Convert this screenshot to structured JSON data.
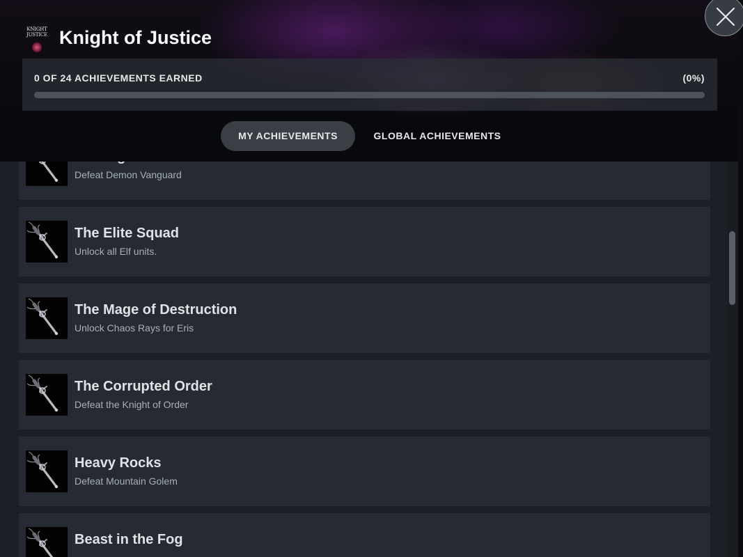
{
  "game": {
    "title": "Knight of Justice",
    "logo_line1": "KNIGHT",
    "logo_line2": "JUSTICE"
  },
  "progress": {
    "label": "0 OF 24 ACHIEVEMENTS EARNED",
    "percent_text": "(0%)",
    "earned": 0,
    "total": 24,
    "fraction": 0,
    "bar_color": "#1a9fff",
    "track_color": "#4d525b"
  },
  "tabs": [
    {
      "label": "MY ACHIEVEMENTS",
      "active": true
    },
    {
      "label": "GLOBAL ACHIEVEMENTS",
      "active": false
    }
  ],
  "achievements": [
    {
      "title": "Just Uglier",
      "description": "Defeat Demon Vanguard",
      "icon": "sword-icon"
    },
    {
      "title": "The Elite Squad",
      "description": "Unlock all Elf units.",
      "icon": "sword-icon"
    },
    {
      "title": "The Mage of Destruction",
      "description": "Unlock Chaos Rays for Eris",
      "icon": "sword-icon"
    },
    {
      "title": "The Corrupted Order",
      "description": "Defeat the Knight of Order",
      "icon": "sword-icon"
    },
    {
      "title": "Heavy Rocks",
      "description": "Defeat Mountain Golem",
      "icon": "sword-icon"
    },
    {
      "title": "Beast in the Fog",
      "description": "",
      "icon": "sword-icon"
    }
  ],
  "icons": {
    "close": "close-icon",
    "achievement": "sword-icon"
  }
}
